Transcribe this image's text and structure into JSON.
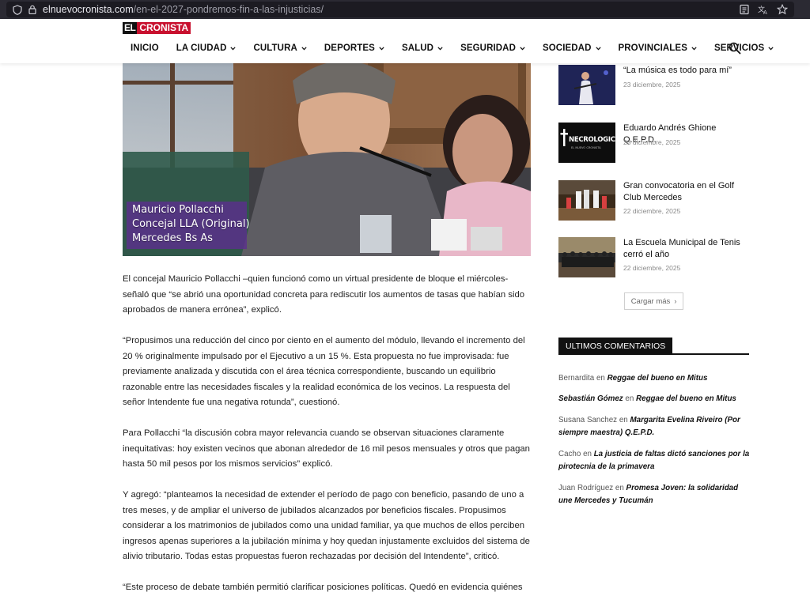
{
  "browser": {
    "url_domain": "elnuevocronista.com",
    "url_path": "/en-el-2027-pondremos-fin-a-las-injusticias/"
  },
  "site": {
    "logo_prefix": "EL",
    "logo_small": "NUEVO",
    "logo_main": "CRONISTA"
  },
  "nav": {
    "items": [
      {
        "label": "INICIO",
        "dropdown": false
      },
      {
        "label": "LA CIUDAD",
        "dropdown": true
      },
      {
        "label": "CULTURA",
        "dropdown": true
      },
      {
        "label": "DEPORTES",
        "dropdown": true
      },
      {
        "label": "SALUD",
        "dropdown": true
      },
      {
        "label": "SEGURIDAD",
        "dropdown": true
      },
      {
        "label": "SOCIEDAD",
        "dropdown": true
      },
      {
        "label": "PROVINCIALES",
        "dropdown": true
      },
      {
        "label": "SERVICIOS",
        "dropdown": true
      }
    ]
  },
  "hero": {
    "caption": [
      "Mauricio Pollacchi",
      "Concejal LLA (Original)",
      "Mercedes Bs As"
    ]
  },
  "article": {
    "paragraphs": [
      "El concejal Mauricio Pollacchi –quien funcionó como un virtual presidente de bloque el miércoles- señaló que “se abrió una oportunidad concreta para rediscutir los aumentos de tasas que habían sido aprobados de manera errónea”, explicó.",
      "“Propusimos una reducción del cinco por ciento en el aumento del módulo, llevando el incremento del 20 % originalmente impulsado por el Ejecutivo a un 15 %. Esta propuesta no fue improvisada: fue previamente analizada y discutida con el área técnica correspondiente, buscando un equilibrio razonable entre las necesidades fiscales y la realidad económica de los vecinos. La respuesta del señor Intendente fue una negativa rotunda”, cuestionó.",
      "Para Pollacchi “la discusión cobra mayor relevancia cuando se observan situaciones claramente inequitativas: hoy existen vecinos que abonan alrededor de 16 mil pesos mensuales y otros que pagan hasta 50 mil pesos por los mismos servicios” explicó.",
      "Y agregó: “planteamos la necesidad de extender el período de pago con beneficio, pasando de uno a tres meses, y de ampliar el universo de jubilados alcanzados por beneficios fiscales. Propusimos considerar a los matrimonios de jubilados como una unidad familiar, ya que muchos de ellos perciben ingresos apenas superiores a la jubilación mínima y hoy quedan injustamente excluidos del sistema de alivio tributario. Todas estas propuestas fueron rechazadas por decisión del Intendente”, criticó.",
      "“Este proceso de debate también permitió clarificar posiciones políticas. Quedó en evidencia quiénes"
    ]
  },
  "sidebar": {
    "posts": [
      {
        "title": "“La música es todo para mí”",
        "date": "23 diciembre, 2025"
      },
      {
        "title": "Eduardo Andrés Ghione Q.E.P.D.",
        "date": "23 diciembre, 2025",
        "thumb_text": "NECROLOGICAS",
        "thumb_sub": "EL NUEVO CRONISTA"
      },
      {
        "title": "Gran convocatoria en el Golf Club Mercedes",
        "date": "22 diciembre, 2025"
      },
      {
        "title": "La Escuela Municipal de Tenis cerró el año",
        "date": "22 diciembre, 2025"
      }
    ],
    "load_more": "Cargar más",
    "comments_heading": "ULTIMOS COMENTARIOS",
    "comments": [
      {
        "author": "Bernardita",
        "author_link": false,
        "sep": "en",
        "post": "Reggae del bueno en Mitus"
      },
      {
        "author": "Sebastián Gómez",
        "author_link": true,
        "sep": "en",
        "post": "Reggae del bueno en Mitus"
      },
      {
        "author": "Susana Sanchez",
        "author_link": false,
        "sep": "en",
        "post": "Margarita Evelina Riveiro (Por siempre maestra) Q.E.P.D."
      },
      {
        "author": "Cacho",
        "author_link": false,
        "sep": "en",
        "post": "La justicia de faltas dictó sanciones por la pirotecnia de la primavera"
      },
      {
        "author": "Juan Rodríguez",
        "author_link": false,
        "sep": "en",
        "post": "Promesa Joven: la solidaridad une Mercedes y Tucumán"
      }
    ]
  }
}
